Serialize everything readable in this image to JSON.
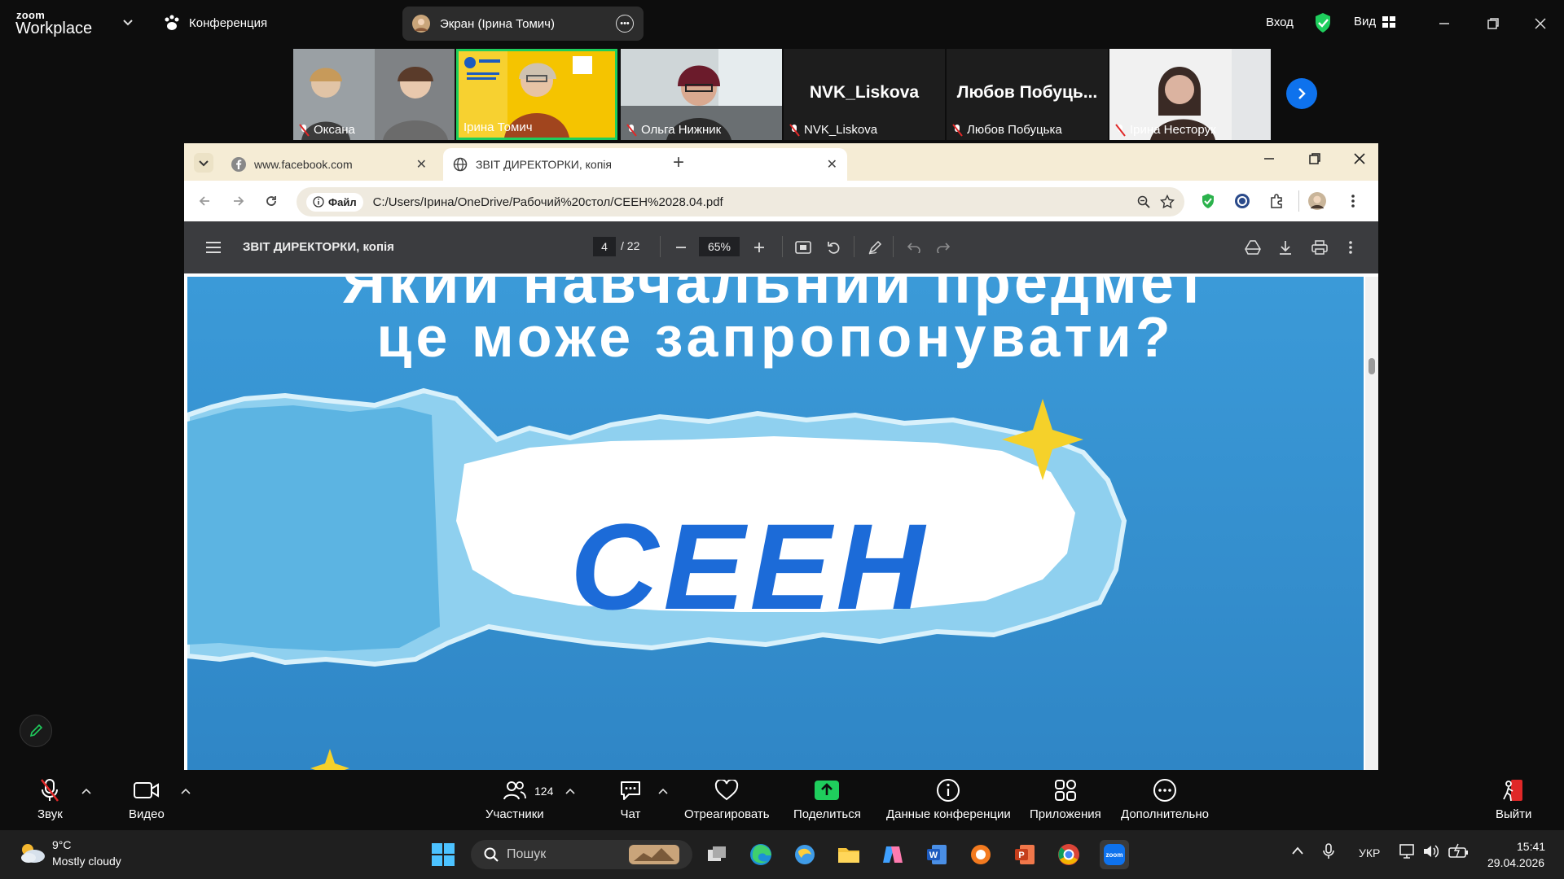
{
  "zoom_top": {
    "logo_small": "zoom",
    "logo_big": "Workplace",
    "conference_label": "Конференция",
    "share_label": "Экран (Ірина Томич)",
    "login": "Вход",
    "view": "Вид"
  },
  "participants": [
    {
      "name": "Оксана",
      "muted": true
    },
    {
      "name": "Ірина Томич",
      "muted": false,
      "active": true
    },
    {
      "name": "Ольга Нижник",
      "muted": true
    },
    {
      "name": "NVK_Liskova",
      "big_name": "NVK_Liskova",
      "muted": true
    },
    {
      "name": "Любов Побуцька",
      "big_name": "Любов Побуць...",
      "muted": true
    },
    {
      "name": "Ірина Несторук",
      "muted": true
    }
  ],
  "browser": {
    "tabs": [
      {
        "title": "www.facebook.com"
      },
      {
        "title": "ЗВІТ ДИРЕКТОРКИ, копія"
      }
    ],
    "file_chip": "Файл",
    "url": "C:/Users/Ірина/OneDrive/Рабочий%20стол/СЕЕН%2028.04.pdf"
  },
  "pdf": {
    "title": "ЗВІТ ДИРЕКТОРКИ, копія",
    "page_current": "4",
    "page_total": "/ 22",
    "zoom": "65%",
    "slide_heading_top": "Який навчальний предмет",
    "slide_heading": "це може запропонувати?",
    "slide_word": "СЕЕН"
  },
  "controls": {
    "audio": "Звук",
    "video": "Видео",
    "participants": "Участники",
    "participants_count": "124",
    "chat": "Чат",
    "react": "Отреагировать",
    "share": "Поделиться",
    "info": "Данные конференции",
    "apps": "Приложения",
    "more": "Дополнительно",
    "leave": "Выйти"
  },
  "taskbar": {
    "temp": "9°C",
    "weather": "Mostly cloudy",
    "search": "Пошук",
    "lang": "УКР",
    "time": "15:41",
    "date": "29.04.2026"
  },
  "colors": {
    "zoom_bg": "#0d0d0d",
    "active_speaker": "#1fce5d",
    "zoom_blue": "#0e72ed",
    "share_green": "#1fce5d",
    "slide_blue": "#3a97d6",
    "slide_word": "#1c6bd8",
    "star": "#f5d12a"
  }
}
